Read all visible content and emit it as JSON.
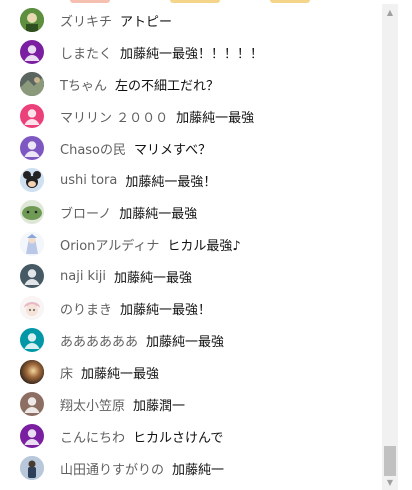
{
  "chat": {
    "messages": [
      {
        "author": "ズリキチ",
        "text": "アトピー",
        "avatar": "green-figure-avatar-icon"
      },
      {
        "author": "しまたく",
        "text": "加藤純一最強！！！！！",
        "avatar": "default-purple-avatar-icon"
      },
      {
        "author": "Tちゃん",
        "text": "左の不細工だれ？",
        "avatar": "photo-avatar-icon"
      },
      {
        "author": "マリリン ２０００",
        "text": "加藤純一最強",
        "avatar": "default-pink-avatar-icon"
      },
      {
        "author": "Chasoの民",
        "text": "マリメすべ？",
        "avatar": "default-violet-avatar-icon"
      },
      {
        "author": "ushi tora",
        "text": "加藤純一最強！",
        "avatar": "mouse-character-avatar-icon"
      },
      {
        "author": "ブローノ",
        "text": "加藤純一最強",
        "avatar": "green-creature-avatar-icon"
      },
      {
        "author": "Orionアルディナ",
        "text": "ヒカル最強♪",
        "avatar": "anime-character-avatar-icon"
      },
      {
        "author": "naji kiji",
        "text": "加藤純一最強",
        "avatar": "default-slate-avatar-icon"
      },
      {
        "author": "のりまき",
        "text": "加藤純一最強！",
        "avatar": "anime-face-avatar-icon"
      },
      {
        "author": "ああああああ",
        "text": "加藤純一最強",
        "avatar": "default-teal-avatar-icon"
      },
      {
        "author": "床",
        "text": "加藤純一最強",
        "avatar": "sunset-avatar-icon"
      },
      {
        "author": "翔太小笠原",
        "text": "加藤潤一",
        "avatar": "default-brown-avatar-icon"
      },
      {
        "author": "こんにちわ",
        "text": "ヒカルさけんで",
        "avatar": "default-purple-avatar-icon"
      },
      {
        "author": "山田通りすがりの",
        "text": "加藤純一",
        "avatar": "person-photo-avatar-icon"
      }
    ]
  },
  "colors": {
    "author": "#606060",
    "message": "#111111",
    "purple": "#7b1fa2",
    "pink": "#ec407a",
    "violet": "#7e57c2",
    "slate": "#455a64",
    "teal": "#0097a7",
    "brown": "#8d6e63"
  }
}
